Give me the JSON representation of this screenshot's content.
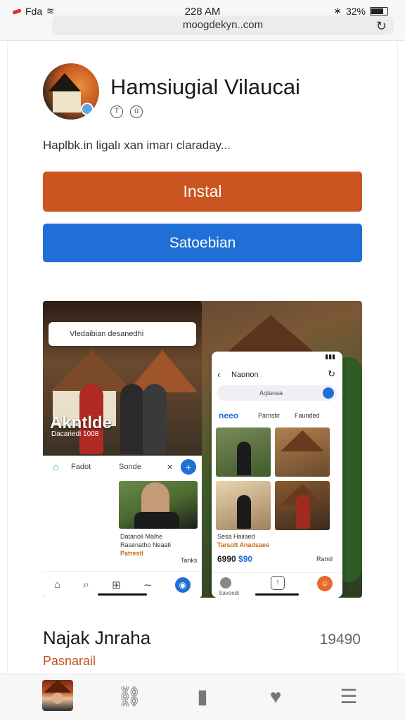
{
  "status_bar": {
    "carrier": "Fda",
    "time": "228 AM",
    "battery": "32%"
  },
  "browser": {
    "url": "moogdekyn..com"
  },
  "app": {
    "title": "Hamsiugial Vilaucai",
    "subtitle": "Haplbk.in ligalı xan imarı claraday...",
    "install_label": "Instal",
    "secondary_label": "Satoebian",
    "accent_install": "#c9541f",
    "accent_secondary": "#1f6fd6"
  },
  "screenshots": {
    "left": {
      "search_text": "Vledaibian desanedhi",
      "overlay_title": "Akntlde",
      "overlay_sub": "Dacariedi 1008",
      "bar_label_1": "Fadot",
      "bar_label_2": "Sonde",
      "info_1": "Datanoli Malhe",
      "info_2": "Rasenatho Neaati",
      "info_3": "Patrestl",
      "info_4": "Tanks"
    },
    "right": {
      "header_title": "Naonon",
      "search_text": "Aqlanaa",
      "tab_1": "neeo",
      "tab_2": "Parnstir",
      "tab_3": "Faunded",
      "info_1": "Sesa Haiiaed",
      "info_2": "Tarsolt Anadsaee",
      "price": "6990",
      "price_highlight": "$90",
      "side_label": "Ramil",
      "nav_label": "Savoedi"
    }
  },
  "developer": {
    "name": "Najak Jnraha",
    "count": "19490",
    "tag": "Pasnarail"
  },
  "bottom_nav": {
    "items": [
      "profile",
      "link",
      "library",
      "heart",
      "menu"
    ]
  }
}
